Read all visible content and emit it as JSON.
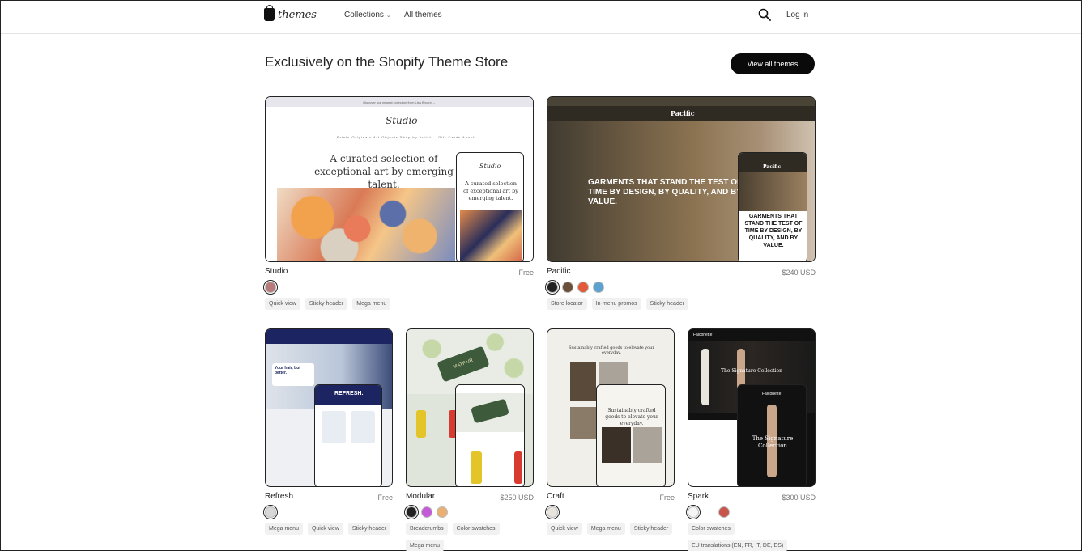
{
  "header": {
    "logo_text": "themes",
    "nav_collections": "Collections",
    "nav_all_themes": "All themes",
    "login": "Log in"
  },
  "section": {
    "title": "Exclusively on the Shopify Theme Store",
    "view_all": "View all themes"
  },
  "themes": [
    {
      "name": "Studio",
      "price": "Free",
      "swatches": [
        "#b87a7a"
      ],
      "tags": [
        "Quick view",
        "Sticky header",
        "Mega menu"
      ],
      "preview": {
        "topline": "Discover our newest collection from Lisa Bryant →",
        "logo": "Studio",
        "menu": "Prints   Originals   Art Objects   Shop by Artist ⌄   Gift Cards   About ⌄",
        "headline": "A curated selection of exceptional art by emerging talent.",
        "phone_headline": "A curated selection of exceptional art by emerging talent."
      }
    },
    {
      "name": "Pacific",
      "price": "$240 USD",
      "swatches": [
        "#222222",
        "#6b4f3a",
        "#e35a3a",
        "#5ba2d0"
      ],
      "tags": [
        "Store locator",
        "In-menu promos",
        "Sticky header"
      ],
      "preview": {
        "logo": "Pacific",
        "headline": "GARMENTS THAT STAND THE TEST OF TIME BY DESIGN, BY QUALITY, AND BY VALUE.",
        "phone_headline": "GARMENTS THAT STAND THE TEST OF TIME BY DESIGN, BY QUALITY, AND BY VALUE."
      }
    },
    {
      "name": "Refresh",
      "price": "Free",
      "swatches": [
        "#d8d8d8"
      ],
      "tags": [
        "Mega menu",
        "Quick view",
        "Sticky header"
      ],
      "preview": {
        "logo": "REFRESH.",
        "headline": "Your hair, but better."
      }
    },
    {
      "name": "Modular",
      "price": "$250 USD",
      "swatches": [
        "#222222",
        "#c45bd6",
        "#eab073"
      ],
      "tags": [
        "Breadcrumbs",
        "Color swatches",
        "Mega menu"
      ],
      "preview": {
        "logo": "MATFAIR"
      }
    },
    {
      "name": "Craft",
      "price": "Free",
      "swatches": [
        "#e6e4dc"
      ],
      "tags": [
        "Quick view",
        "Mega menu",
        "Sticky header"
      ],
      "preview": {
        "headline": "Sustainably crafted goods to elevate your everyday."
      }
    },
    {
      "name": "Spark",
      "price": "$300 USD",
      "swatches": [
        "#f5f5f5",
        "#ffffff",
        "#c9544a"
      ],
      "tags": [
        "Color swatches",
        "EU translations (EN, FR, IT, DE, ES)"
      ],
      "preview": {
        "logo": "Falconette",
        "headline": "The Signature Collection"
      }
    }
  ]
}
